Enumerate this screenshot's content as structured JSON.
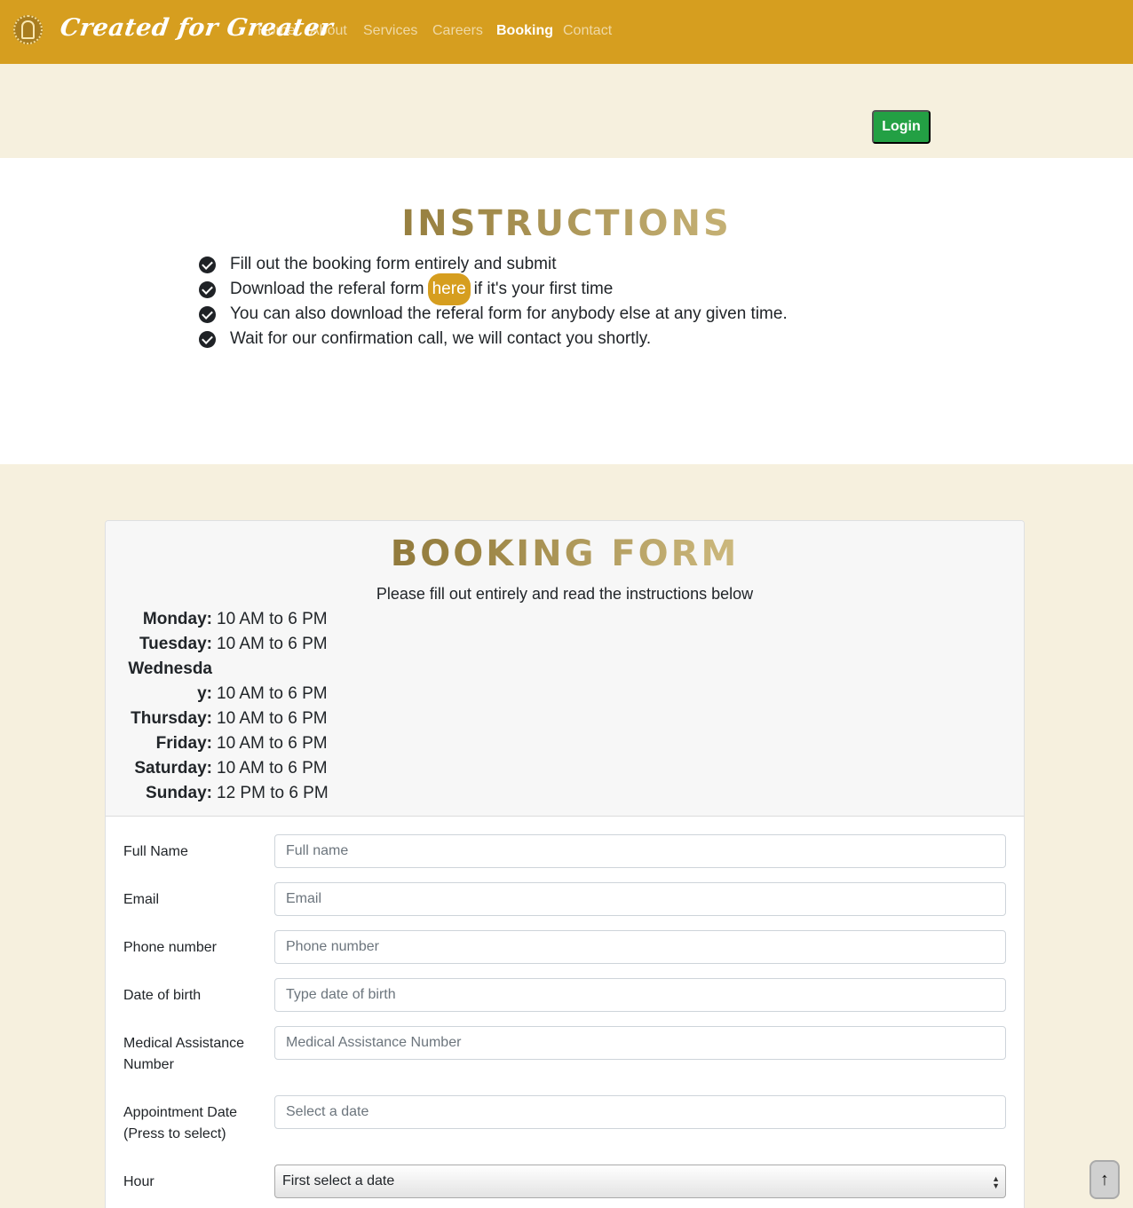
{
  "nav": {
    "brand": "Created for Greater",
    "items": [
      {
        "label": "Home",
        "active": false
      },
      {
        "label": "About",
        "active": false
      },
      {
        "label": "Services",
        "active": false
      },
      {
        "label": "Careers",
        "active": false
      },
      {
        "label": "Booking",
        "active": true
      },
      {
        "label": "Contact",
        "active": false
      }
    ]
  },
  "login": {
    "label": "Login"
  },
  "instructions": {
    "title": "INSTRUCTIONS",
    "items": [
      "Fill out the booking form entirely and submit",
      "Download the referal form",
      "if it's your first time",
      "You can also download the referal form for anybody else at any given time.",
      "Wait for our confirmation call, we will contact you shortly."
    ],
    "here_link": "here"
  },
  "booking": {
    "title": "BOOKING FORM",
    "subtitle": "Please fill out entirely and read the instructions below",
    "hours": [
      {
        "day": "Monday:",
        "time": "10 AM to 6 PM"
      },
      {
        "day": "Tuesday:",
        "time": "10 AM to 6 PM"
      },
      {
        "day": "Wednesday:",
        "time": "10 AM to 6 PM"
      },
      {
        "day": "Thursday:",
        "time": "10 AM to 6 PM"
      },
      {
        "day": "Friday:",
        "time": "10 AM to 6 PM"
      },
      {
        "day": "Saturday:",
        "time": "10 AM to 6 PM"
      },
      {
        "day": "Sunday:",
        "time": "12 PM to 6 PM"
      }
    ],
    "fields": {
      "full_name": {
        "label": "Full Name",
        "placeholder": "Full name"
      },
      "email": {
        "label": "Email",
        "placeholder": "Email"
      },
      "phone": {
        "label": "Phone number",
        "placeholder": "Phone number"
      },
      "dob": {
        "label": "Date of birth",
        "placeholder": "Type date of birth"
      },
      "medical": {
        "label": "Medical Assistance Number",
        "placeholder": "Medical Assistance Number"
      },
      "appointment": {
        "label": "Appointment Date (Press to select)",
        "placeholder": "Select a date"
      },
      "hour": {
        "label": "Hour",
        "value": "First select a date"
      }
    }
  },
  "icons": {
    "check": "check-circle-icon",
    "scroll_top": "arrow-up-icon",
    "logo": "logo-icon"
  },
  "colors": {
    "navbar": "#d69e1f",
    "login_button": "#23a044",
    "page_bg": "#f6f0de"
  }
}
